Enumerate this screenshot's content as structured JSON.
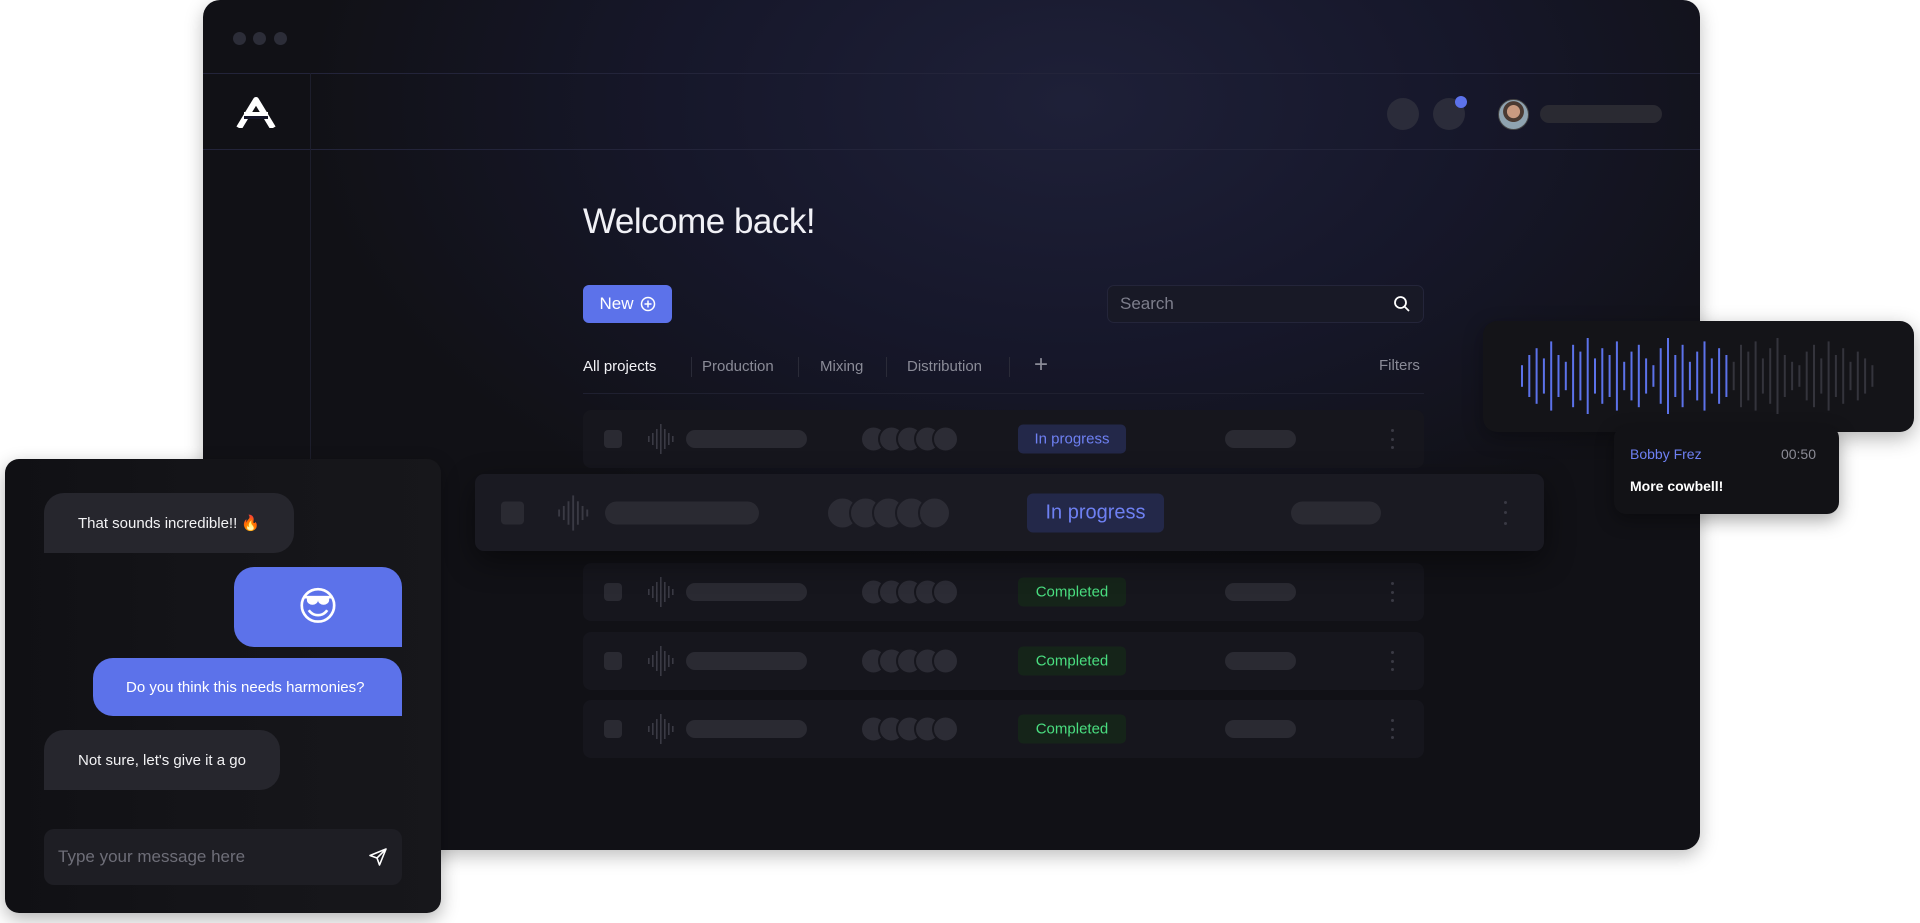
{
  "colors": {
    "accent": "#5c72ea",
    "in_progress": "#6e80f2",
    "completed": "#4ade80",
    "notification": "#5c72ea"
  },
  "header": {
    "logo_icon": "a-logo-icon",
    "notification_dot": true
  },
  "main": {
    "title": "Welcome back!",
    "new_label": "New",
    "search": {
      "placeholder": "Search",
      "value": ""
    },
    "tabs": [
      {
        "label": "All projects",
        "active": true
      },
      {
        "label": "Production"
      },
      {
        "label": "Mixing"
      },
      {
        "label": "Distribution"
      }
    ],
    "add_tab_label": "+",
    "filters_label": "Filters",
    "rows": [
      {
        "status": "In progress",
        "kind": "ip"
      },
      {
        "status": "Completed",
        "kind": "cp"
      },
      {
        "status": "Completed",
        "kind": "cp"
      },
      {
        "status": "Completed",
        "kind": "cp"
      }
    ],
    "highlight_row": {
      "status": "In progress",
      "kind": "ip"
    }
  },
  "waveform": {
    "played_fraction": 0.6,
    "levels": [
      0.2,
      0.5,
      0.7,
      0.4,
      0.9,
      0.5,
      0.3,
      0.8,
      0.6,
      1.0,
      0.4,
      0.7,
      0.5,
      0.9,
      0.3,
      0.6,
      0.8,
      0.4,
      0.2,
      0.7,
      1.0,
      0.5,
      0.8,
      0.3,
      0.6,
      0.9,
      0.4,
      0.7,
      0.5,
      0.3,
      0.8,
      0.6,
      0.9,
      0.4,
      0.7,
      1.0,
      0.5,
      0.3,
      0.2,
      0.6,
      0.8,
      0.4,
      0.9,
      0.5,
      0.7,
      0.3,
      0.6,
      0.4,
      0.2
    ]
  },
  "comment": {
    "author": "Bobby Frez",
    "time": "00:50",
    "text": "More cowbell!"
  },
  "chat": {
    "messages": [
      {
        "text": "That sounds  incredible!! 🔥",
        "dir": "in"
      },
      {
        "text": "😎",
        "dir": "out"
      },
      {
        "text": "Do you think this needs harmonies?",
        "dir": "out"
      },
      {
        "text": "Not sure, let's give it a go",
        "dir": "in"
      }
    ],
    "input_placeholder": "Type your message here"
  }
}
